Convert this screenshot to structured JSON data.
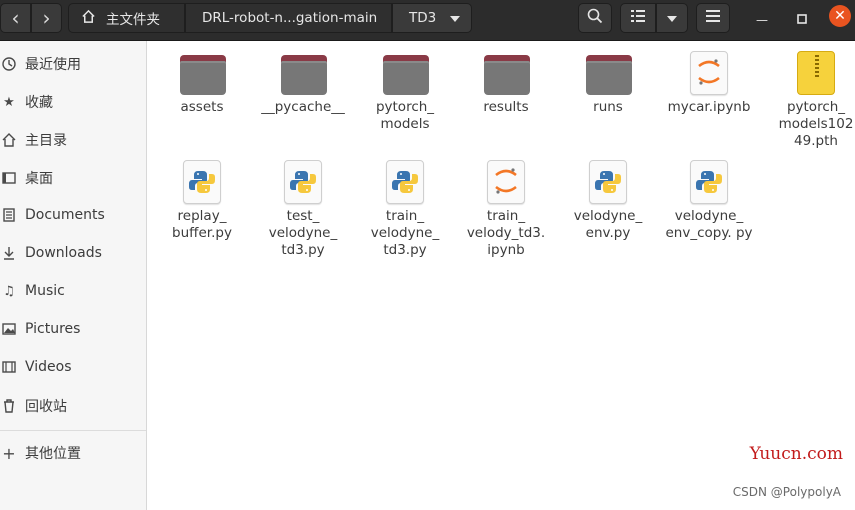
{
  "header": {
    "back_label": "‹",
    "forward_label": "›",
    "breadcrumbs": [
      {
        "label": "主文件夹",
        "icon": "home-icon"
      },
      {
        "label": "DRL-robot-n...gation-main"
      },
      {
        "label": "TD3"
      }
    ],
    "dropdown_icon": "chevron-down-icon",
    "search_icon": "search-icon",
    "view_icon": "list-view-icon",
    "menu_icon": "hamburger-menu-icon",
    "minimize_label": "—",
    "maximize_label": "□",
    "close_label": "✕",
    "accent": "#e95420"
  },
  "sidebar": {
    "items": [
      {
        "label": "最近使用",
        "icon": "clock-icon"
      },
      {
        "label": "收藏",
        "icon": "star-icon"
      },
      {
        "label": "主目录",
        "icon": "home-icon"
      },
      {
        "label": "桌面",
        "icon": "desktop-icon"
      },
      {
        "label": "Documents",
        "icon": "document-icon"
      },
      {
        "label": "Downloads",
        "icon": "download-icon"
      },
      {
        "label": "Music",
        "icon": "music-icon"
      },
      {
        "label": "Pictures",
        "icon": "picture-icon"
      },
      {
        "label": "Videos",
        "icon": "video-icon"
      },
      {
        "label": "回收站",
        "icon": "trash-icon"
      },
      {
        "label": "其他位置",
        "icon": "plus-icon"
      }
    ]
  },
  "files": [
    {
      "name": "assets",
      "type": "folder"
    },
    {
      "name": "__pycache__",
      "type": "folder"
    },
    {
      "name": "pytorch_ models",
      "type": "folder"
    },
    {
      "name": "results",
      "type": "folder"
    },
    {
      "name": "runs",
      "type": "folder"
    },
    {
      "name": "mycar.ipynb",
      "type": "notebook"
    },
    {
      "name": "pytorch_ models102 49.pth",
      "type": "archive"
    },
    {
      "name": "replay_ buffer.py",
      "type": "python"
    },
    {
      "name": "test_ velodyne_ td3.py",
      "type": "python"
    },
    {
      "name": "train_ velodyne_ td3.py",
      "type": "python"
    },
    {
      "name": "train_ velody_td3. ipynb",
      "type": "notebook"
    },
    {
      "name": "velodyne_ env.py",
      "type": "python"
    },
    {
      "name": "velodyne_ env_copy. py",
      "type": "python"
    }
  ],
  "watermarks": {
    "site": "Yuucn.com",
    "csdn": "CSDN @PolypolyA"
  }
}
